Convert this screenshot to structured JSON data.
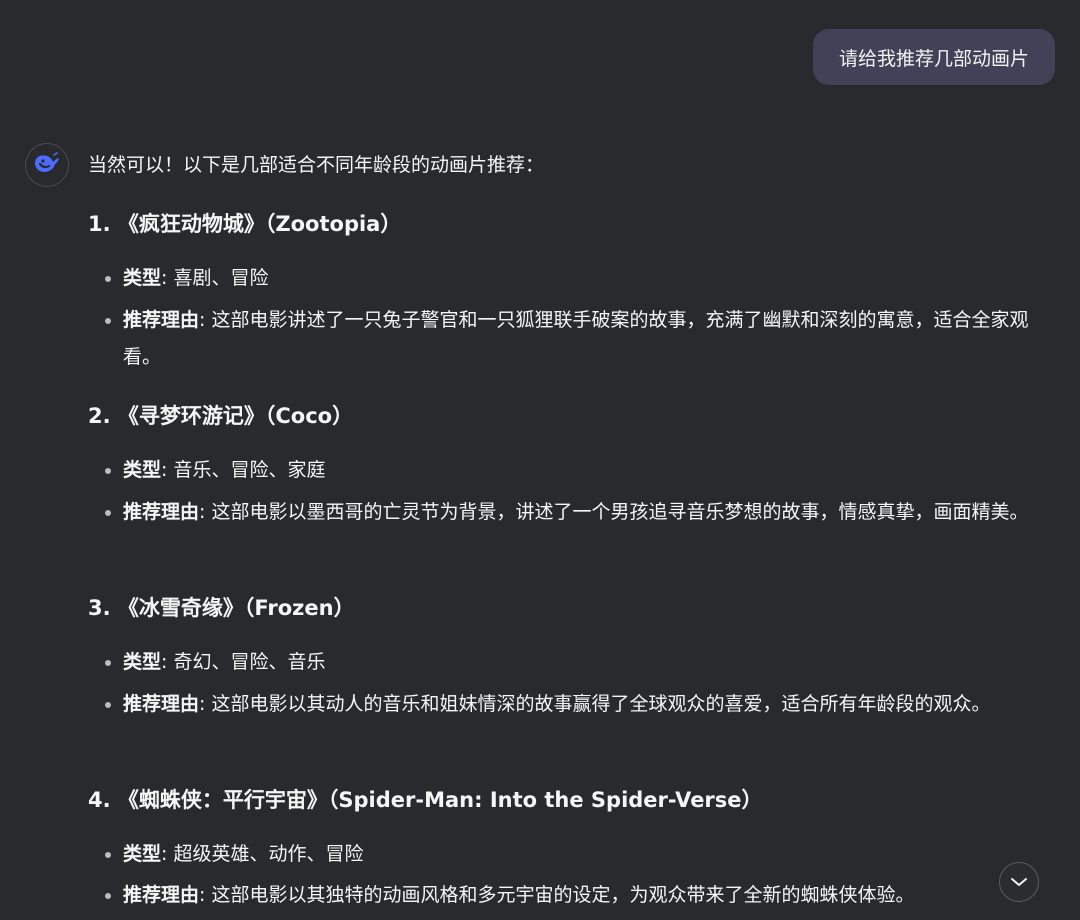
{
  "user_message": "请给我推荐几部动画片",
  "assistant": {
    "intro": "当然可以！以下是几部适合不同年龄段的动画片推荐：",
    "items": [
      {
        "title": "1. 《疯狂动物城》（Zootopia）",
        "genre_label": "类型",
        "genre": ": 喜剧、冒险",
        "reason_label": "推荐理由",
        "reason": ": 这部电影讲述了一只兔子警官和一只狐狸联手破案的故事，充满了幽默和深刻的寓意，适合全家观看。"
      },
      {
        "title": "2. 《寻梦环游记》（Coco）",
        "genre_label": "类型",
        "genre": ": 音乐、冒险、家庭",
        "reason_label": "推荐理由",
        "reason": ": 这部电影以墨西哥的亡灵节为背景，讲述了一个男孩追寻音乐梦想的故事，情感真挚，画面精美。"
      },
      {
        "title": "3. 《冰雪奇缘》（Frozen）",
        "genre_label": "类型",
        "genre": ": 奇幻、冒险、音乐",
        "reason_label": "推荐理由",
        "reason": ": 这部电影以其动人的音乐和姐妹情深的故事赢得了全球观众的喜爱，适合所有年龄段的观众。"
      },
      {
        "title": "4. 《蜘蛛侠：平行宇宙》（Spider-Man: Into the Spider-Verse）",
        "genre_label": "类型",
        "genre": ": 超级英雄、动作、冒险",
        "reason_label": "推荐理由",
        "reason": ": 这部电影以其独特的动画风格和多元宇宙的设定，为观众带来了全新的蜘蛛侠体验。"
      }
    ]
  },
  "icons": {
    "avatar": "whale-logo-icon",
    "scroll": "chevron-down-icon"
  },
  "colors": {
    "background": "#292a2d",
    "user_bubble": "#414158",
    "avatar_accent": "#4d6bfe",
    "text": "#f5f5f5"
  }
}
